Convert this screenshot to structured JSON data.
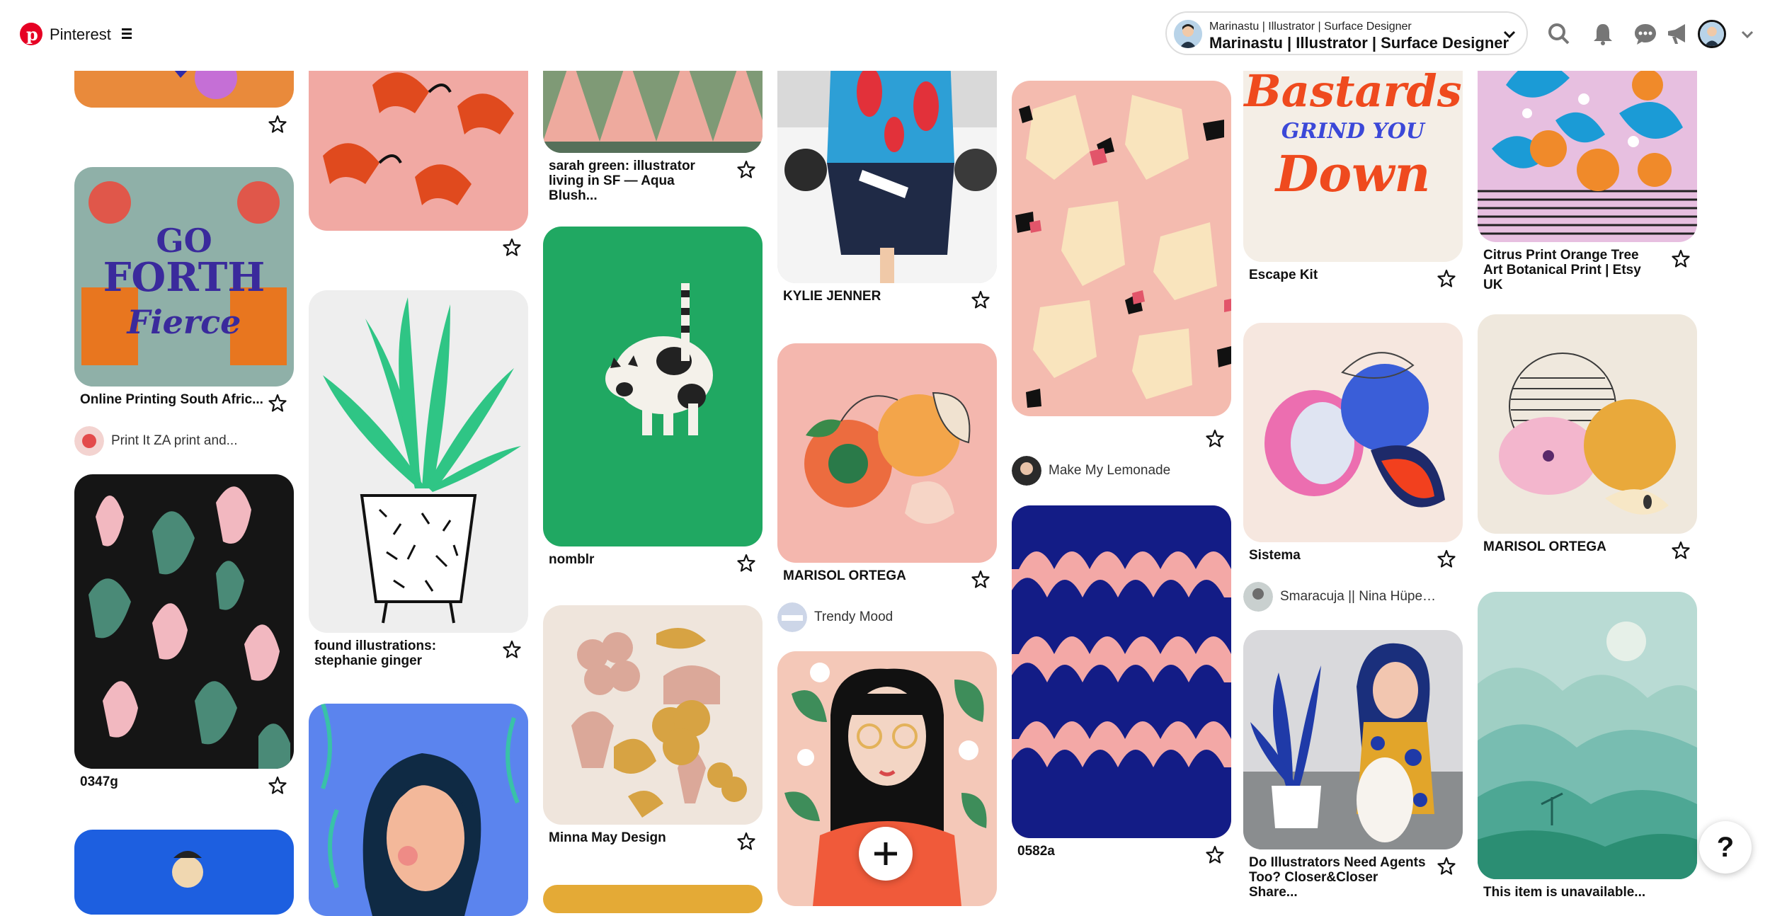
{
  "header": {
    "brand": "Pinterest",
    "account_subtitle": "Marinastu | Illustrator | Surface Designer",
    "account_name": "Marinastu | Illustrator | Surface Designer",
    "icons": [
      "search-icon",
      "bell-icon",
      "chat-icon",
      "megaphone-icon",
      "avatar",
      "chevron-down-icon"
    ]
  },
  "columns": [
    {
      "pins": [
        {
          "title": ""
        },
        {
          "title": "Online Printing South Afric...",
          "source": "Print It ZA print and..."
        },
        {
          "title": "0347g"
        },
        {
          "title": ""
        }
      ]
    },
    {
      "pins": [
        {
          "title": ""
        },
        {
          "title": "found illustrations: stephanie ginger"
        },
        {
          "title": ""
        }
      ]
    },
    {
      "pins": [
        {
          "title": "sarah green: illustrator living in SF — Aqua Blush..."
        },
        {
          "title": "nomblr"
        },
        {
          "title": "Minna May Design"
        },
        {
          "title": ""
        }
      ]
    },
    {
      "pins": [
        {
          "title": "KYLIE JENNER"
        },
        {
          "title": "MARISOL ORTEGA",
          "source": "Trendy Mood"
        },
        {
          "title": ""
        }
      ]
    },
    {
      "pins": [
        {
          "title": "",
          "source": "Make My Lemonade"
        },
        {
          "title": "0582a"
        }
      ]
    },
    {
      "pins": [
        {
          "title": "Escape Kit"
        },
        {
          "title": "Sistema",
          "source": "Smaracuja || Nina Hüpen-..."
        },
        {
          "title": "Do Illustrators Need Agents Too? Closer&Closer Share..."
        }
      ]
    },
    {
      "pins": [
        {
          "title": "Citrus Print Orange Tree Art Botanical Print | Etsy UK"
        },
        {
          "title": "MARISOL ORTEGA"
        },
        {
          "title": "This item is unavailable..."
        }
      ]
    }
  ],
  "help_label": "?",
  "colors": {
    "brand_red": "#e60023"
  }
}
